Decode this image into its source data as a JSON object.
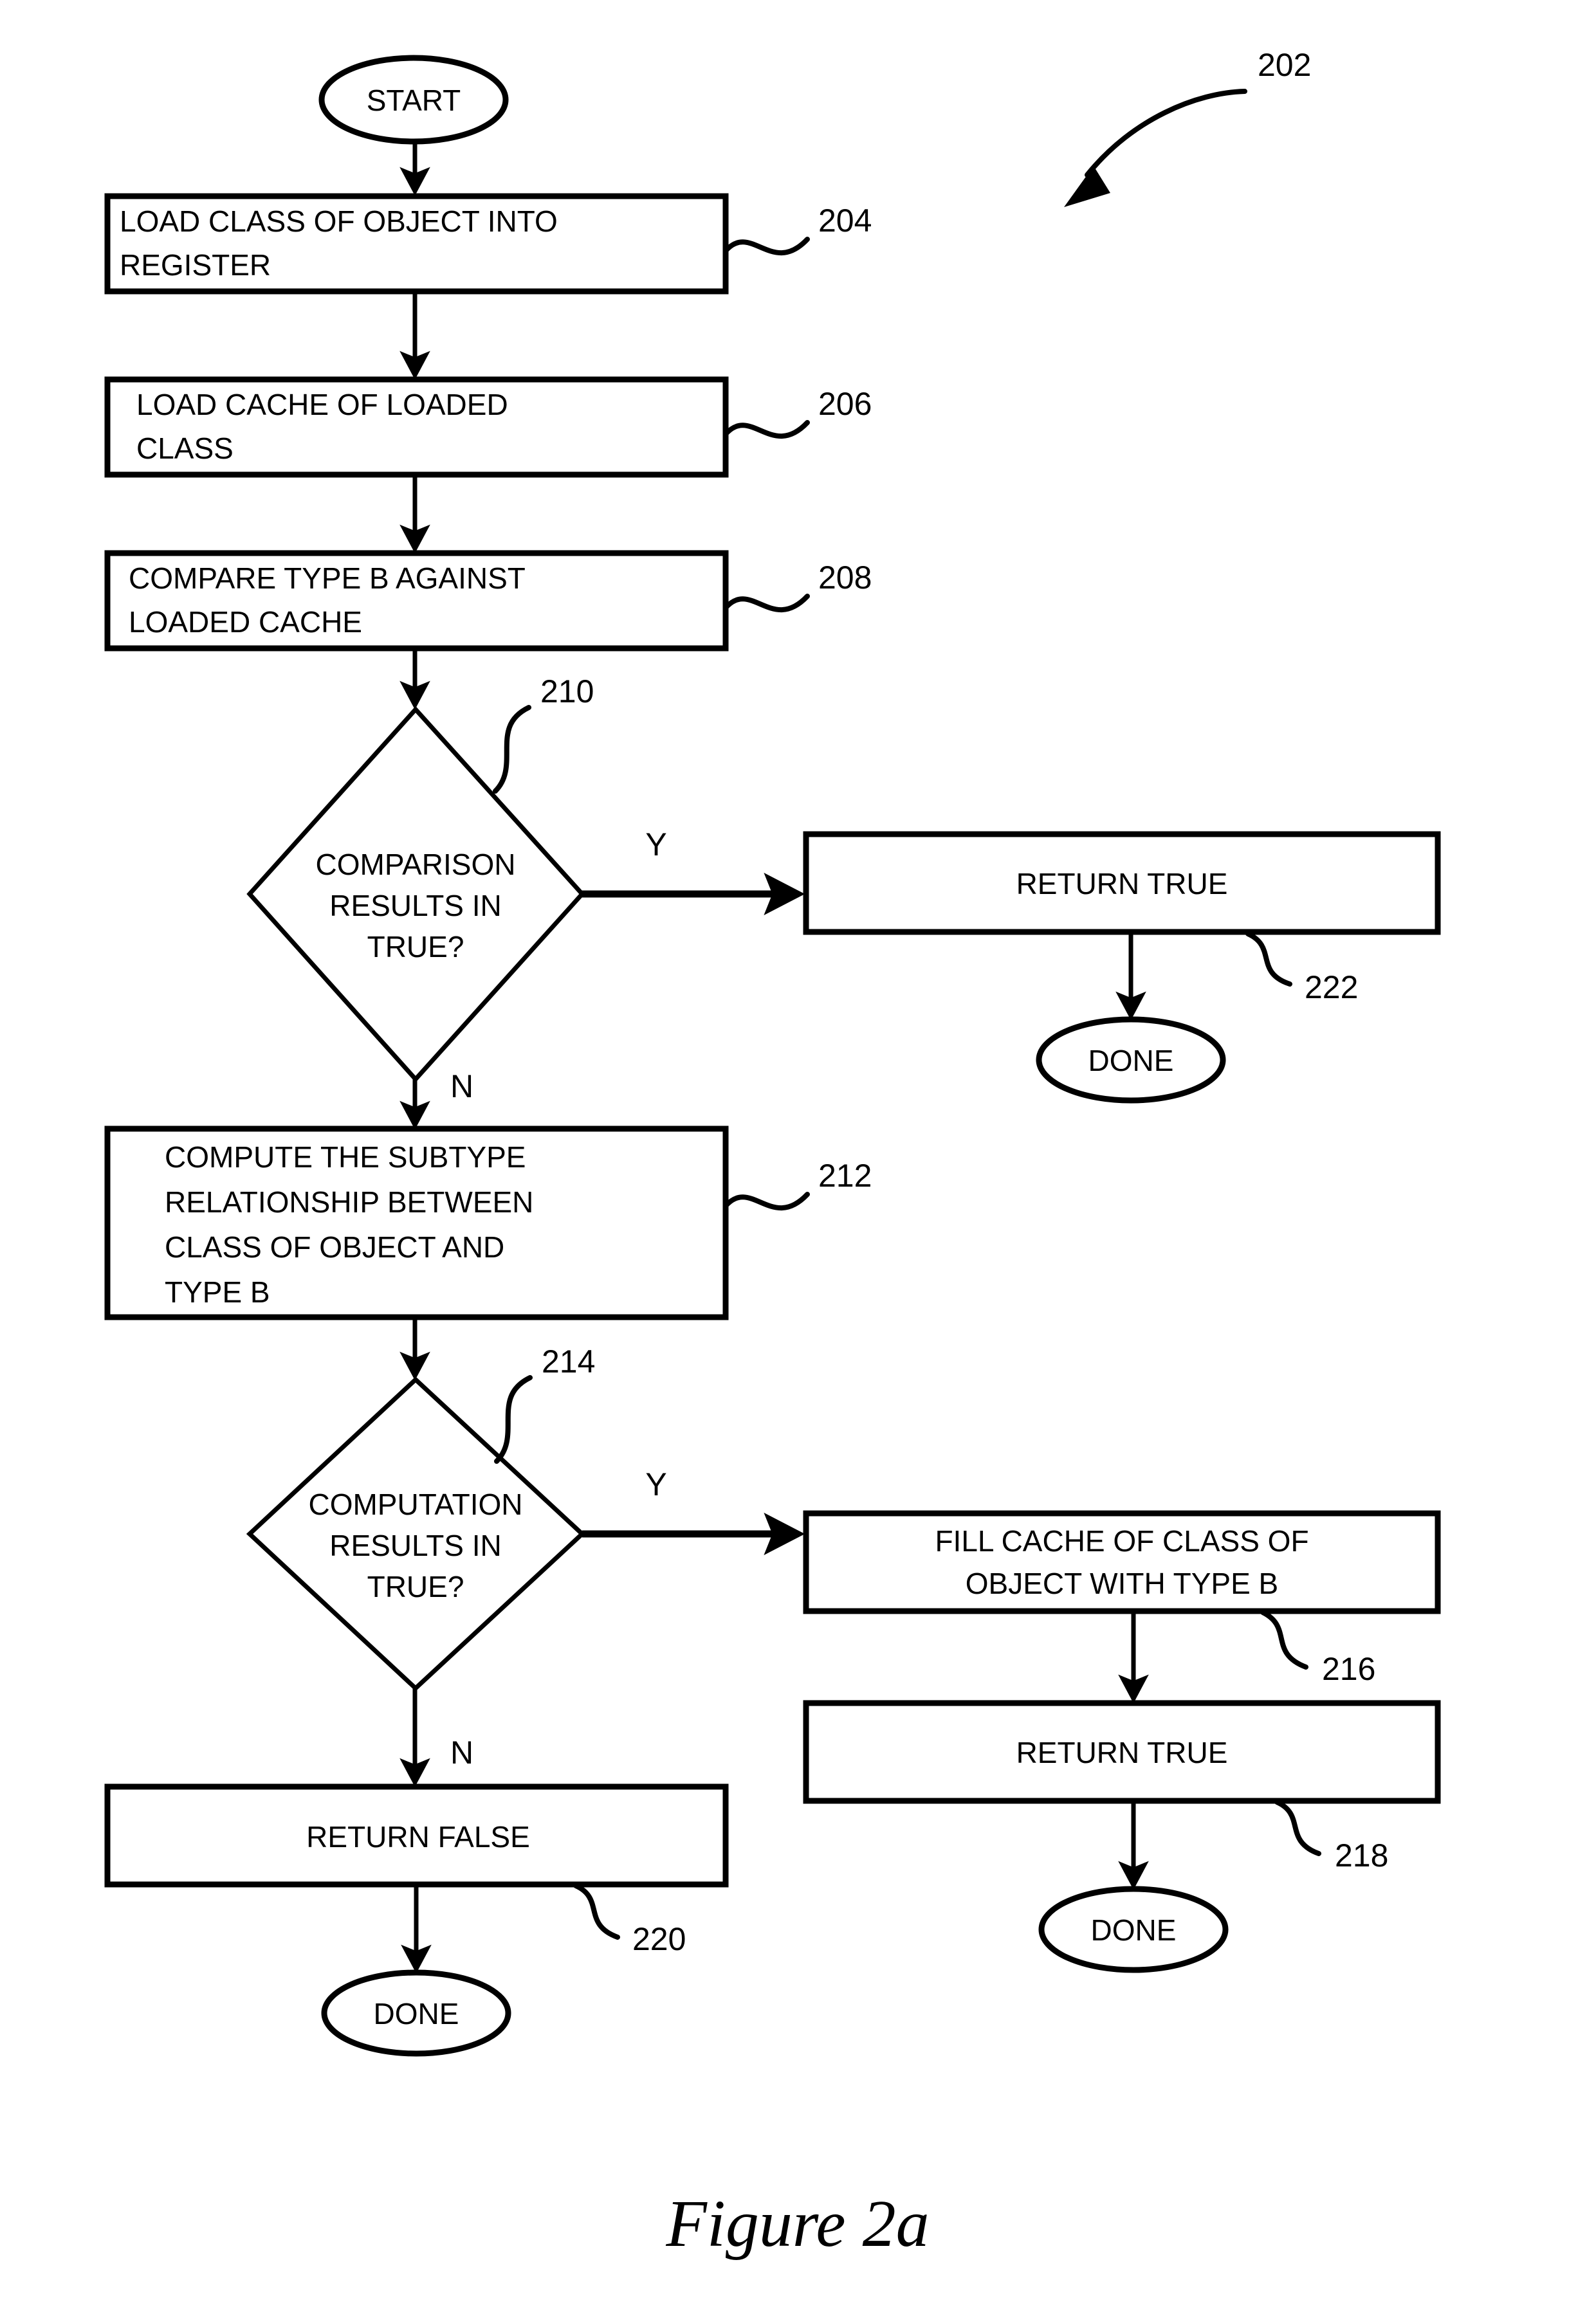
{
  "figure": {
    "caption": "Figure 2a",
    "overall_ref": "202"
  },
  "flowchart": {
    "type": "flowchart",
    "nodes": [
      {
        "id": "start",
        "shape": "terminator",
        "label": "START",
        "ref": null
      },
      {
        "id": "n204",
        "shape": "process",
        "line1": "LOAD CLASS OF OBJECT INTO",
        "line2": "REGISTER",
        "ref": "204"
      },
      {
        "id": "n206",
        "shape": "process",
        "line1": "LOAD CACHE OF LOADED",
        "line2": "CLASS",
        "ref": "206"
      },
      {
        "id": "n208",
        "shape": "process",
        "line1": "COMPARE TYPE B AGAINST",
        "line2": "LOADED CACHE",
        "ref": "208"
      },
      {
        "id": "n210",
        "shape": "decision",
        "line1": "COMPARISON",
        "line2": "RESULTS IN",
        "line3": "TRUE?",
        "ref": "210"
      },
      {
        "id": "n222",
        "shape": "process",
        "line1": "RETURN TRUE",
        "ref": "222"
      },
      {
        "id": "done222",
        "shape": "terminator",
        "label": "DONE",
        "ref": null
      },
      {
        "id": "n212",
        "shape": "process",
        "line1": "COMPUTE THE SUBTYPE",
        "line2": "RELATIONSHIP BETWEEN",
        "line3": "CLASS OF OBJECT AND",
        "line4": "TYPE B",
        "ref": "212"
      },
      {
        "id": "n214",
        "shape": "decision",
        "line1": "COMPUTATION",
        "line2": "RESULTS IN",
        "line3": "TRUE?",
        "ref": "214"
      },
      {
        "id": "n216",
        "shape": "process",
        "line1": "FILL CACHE OF CLASS OF",
        "line2": "OBJECT WITH TYPE B",
        "ref": "216"
      },
      {
        "id": "n218",
        "shape": "process",
        "line1": "RETURN TRUE",
        "ref": "218"
      },
      {
        "id": "done218",
        "shape": "terminator",
        "label": "DONE",
        "ref": null
      },
      {
        "id": "n220",
        "shape": "process",
        "line1": "RETURN FALSE",
        "ref": "220"
      },
      {
        "id": "done220",
        "shape": "terminator",
        "label": "DONE",
        "ref": null
      }
    ],
    "edges": [
      {
        "from": "start",
        "to": "n204",
        "label": ""
      },
      {
        "from": "n204",
        "to": "n206",
        "label": ""
      },
      {
        "from": "n206",
        "to": "n208",
        "label": ""
      },
      {
        "from": "n208",
        "to": "n210",
        "label": ""
      },
      {
        "from": "n210",
        "to": "n222",
        "label": "Y"
      },
      {
        "from": "n210",
        "to": "n212",
        "label": "N"
      },
      {
        "from": "n222",
        "to": "done222",
        "label": ""
      },
      {
        "from": "n212",
        "to": "n214",
        "label": ""
      },
      {
        "from": "n214",
        "to": "n216",
        "label": "Y"
      },
      {
        "from": "n214",
        "to": "n220",
        "label": "N"
      },
      {
        "from": "n216",
        "to": "n218",
        "label": ""
      },
      {
        "from": "n218",
        "to": "done218",
        "label": ""
      },
      {
        "from": "n220",
        "to": "done220",
        "label": ""
      }
    ]
  },
  "labels": {
    "start": "START",
    "done": "DONE",
    "yes": "Y",
    "no": "N",
    "ref_202": "202",
    "ref_204": "204",
    "ref_206": "206",
    "ref_208": "208",
    "ref_210": "210",
    "ref_212": "212",
    "ref_214": "214",
    "ref_216": "216",
    "ref_218": "218",
    "ref_220": "220",
    "ref_222": "222",
    "n204_l1": "LOAD CLASS OF OBJECT INTO",
    "n204_l2": "REGISTER",
    "n206_l1": "LOAD CACHE OF LOADED",
    "n206_l2": "CLASS",
    "n208_l1": "COMPARE TYPE B AGAINST",
    "n208_l2": "LOADED CACHE",
    "n210_l1": "COMPARISON",
    "n210_l2": "RESULTS IN",
    "n210_l3": "TRUE?",
    "n222_l1": "RETURN TRUE",
    "n212_l1": "COMPUTE THE SUBTYPE",
    "n212_l2": "RELATIONSHIP BETWEEN",
    "n212_l3": "CLASS OF OBJECT AND",
    "n212_l4": "TYPE B",
    "n214_l1": "COMPUTATION",
    "n214_l2": "RESULTS IN",
    "n214_l3": "TRUE?",
    "n216_l1": "FILL CACHE OF CLASS OF",
    "n216_l2": "OBJECT WITH TYPE B",
    "n218_l1": "RETURN TRUE",
    "n220_l1": "RETURN FALSE",
    "caption": "Figure 2a"
  },
  "colors": {
    "ink": "#000000",
    "paper": "#ffffff"
  }
}
